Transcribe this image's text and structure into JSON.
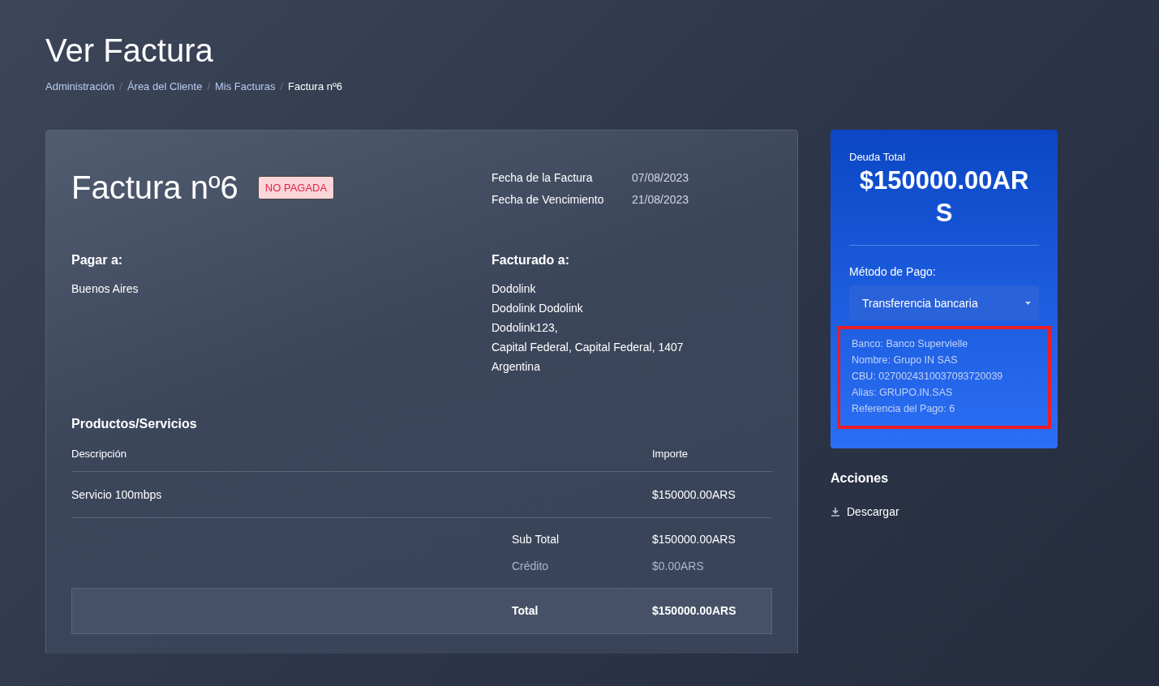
{
  "page_title": "Ver Factura",
  "breadcrumb_separator": "/",
  "breadcrumb": [
    {
      "label": "Administración",
      "current": false
    },
    {
      "label": "Área del Cliente",
      "current": false
    },
    {
      "label": "Mis Facturas",
      "current": false
    },
    {
      "label": "Factura nº6",
      "current": true
    }
  ],
  "invoice": {
    "title": "Factura nº6",
    "status": {
      "label": "NO PAGADA",
      "paid": false
    },
    "dates": [
      {
        "label": "Fecha de la Factura",
        "value": "07/08/2023"
      },
      {
        "label": "Fecha de Vencimiento",
        "value": "21/08/2023"
      }
    ],
    "pay_to": {
      "heading": "Pagar a:",
      "lines": [
        "Buenos Aires"
      ]
    },
    "billed_to": {
      "heading": "Facturado a:",
      "lines": [
        "Dodolink",
        "Dodolink Dodolink",
        "Dodolink123,",
        "Capital Federal, Capital Federal, 1407",
        "Argentina"
      ]
    },
    "items_heading": "Productos/Servicios",
    "columns": [
      "Descripción",
      "Importe"
    ],
    "rows": [
      {
        "description": "Servicio 100mbps",
        "amount": "$150000.00ARS"
      }
    ],
    "totals": [
      {
        "kind": "subtotal",
        "label": "Sub Total",
        "value": "$150000.00ARS"
      },
      {
        "kind": "credit",
        "label": "Crédito",
        "value": "$0.00ARS"
      },
      {
        "kind": "total",
        "label": "Total",
        "value": "$150000.00ARS"
      }
    ]
  },
  "summary": {
    "label": "Deuda Total",
    "amount_lines": [
      "$150000.00AR",
      "S"
    ],
    "method_label": "Método de Pago:",
    "method": "Transferencia bancaria",
    "bank_details": [
      "Banco: Banco Supervielle",
      "Nombre: Grupo IN SAS",
      "CBU: 0270024310037093720039",
      "Alias: GRUPO.IN.SAS",
      "Referencia del Pago: 6"
    ],
    "highlighted": true
  },
  "actions": {
    "heading": "Acciones",
    "items": [
      {
        "label": "Descargar"
      }
    ]
  }
}
